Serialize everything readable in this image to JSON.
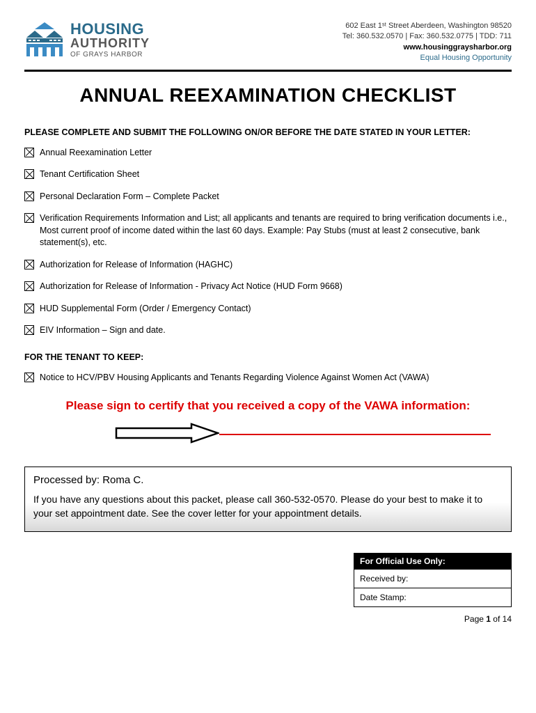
{
  "header": {
    "logo": {
      "title1": "HOUSING",
      "title2": "AUTHORITY",
      "title3": "OF GRAYS HARBOR"
    },
    "contact": {
      "address": "602 East 1ˢᵗ Street Aberdeen, Washington 98520",
      "phone": "Tel:  360.532.0570 | Fax: 360.532.0775 | TDD: 711",
      "website": "www.housinggraysharbor.org",
      "eho": "Equal Housing Opportunity"
    }
  },
  "title": "ANNUAL REEXAMINATION CHECKLIST",
  "section1_heading": "PLEASE COMPLETE AND SUBMIT THE FOLLOWING ON/OR BEFORE THE DATE STATED IN YOUR LETTER:",
  "items1": [
    "Annual Reexamination Letter",
    "Tenant Certification Sheet",
    "Personal Declaration Form – Complete Packet",
    "Verification Requirements Information and List; all applicants and tenants are required to bring verification documents i.e., Most current proof of income dated within the last 60 days.  Example:  Pay Stubs (must at least 2 consecutive, bank statement(s), etc.",
    "Authorization for Release of Information (HAGHC)",
    "Authorization for Release of Information - Privacy Act Notice (HUD Form 9668)",
    "HUD Supplemental Form (Order / Emergency Contact)",
    "EIV Information – Sign and date."
  ],
  "section2_heading": "FOR THE TENANT TO KEEP:",
  "items2": [
    "Notice to HCV/PBV Housing Applicants and Tenants Regarding Violence Against Women Act (VAWA)"
  ],
  "red_heading": "Please sign to certify that you received a copy of the VAWA information:",
  "processed": {
    "line1": "Processed by: Roma C.",
    "line2": "If you have any questions about this packet, please call 360-532-0570.   Please do your best to make it to your set appointment date.  See the cover letter for your appointment details."
  },
  "official": {
    "header": "For Official Use Only:",
    "received": "Received by:",
    "datestamp": "Date Stamp:"
  },
  "page": {
    "prefix": "Page ",
    "current": "1",
    "of": " of ",
    "total": "14"
  }
}
